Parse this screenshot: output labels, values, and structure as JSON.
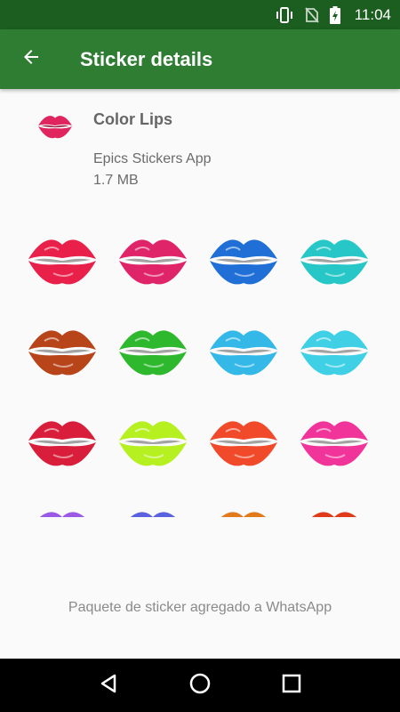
{
  "status_bar": {
    "time": "11:04",
    "icons": [
      "vibrate-icon",
      "no-sim-icon",
      "battery-charging-icon"
    ]
  },
  "app_bar": {
    "back_icon": "arrow-back-icon",
    "title": "Sticker details"
  },
  "pack": {
    "name": "Color Lips",
    "publisher": "Epics Stickers App",
    "size": "1.7 MB",
    "tray_color": "#e0245e"
  },
  "stickers": [
    {
      "name": "red-lips",
      "color": "#e8204a"
    },
    {
      "name": "crimson-pink-lips",
      "color": "#e0246a"
    },
    {
      "name": "blue-lips",
      "color": "#1f6fd6"
    },
    {
      "name": "turquoise-lips",
      "color": "#27c7c7"
    },
    {
      "name": "brown-lips",
      "color": "#b8441a"
    },
    {
      "name": "green-lips",
      "color": "#2db82d"
    },
    {
      "name": "sky-blue-lips",
      "color": "#33b8e8"
    },
    {
      "name": "aqua-lips",
      "color": "#3fd0e6"
    },
    {
      "name": "dark-red-lips",
      "color": "#d81e3a"
    },
    {
      "name": "lime-lips",
      "color": "#b6f020"
    },
    {
      "name": "orange-red-lips",
      "color": "#f04a2a"
    },
    {
      "name": "magenta-lips",
      "color": "#f0349a"
    },
    {
      "name": "purple-lips",
      "color": "#9a5ae6"
    },
    {
      "name": "indigo-lips",
      "color": "#5a62e0"
    },
    {
      "name": "amber-lips",
      "color": "#e07a1a"
    },
    {
      "name": "scarlet-lips",
      "color": "#e03a1a"
    }
  ],
  "footer": {
    "status_text": "Paquete de sticker agregado a WhatsApp"
  },
  "nav_bar": {
    "buttons": [
      "back-triangle-icon",
      "home-circle-icon",
      "recents-square-icon"
    ]
  }
}
